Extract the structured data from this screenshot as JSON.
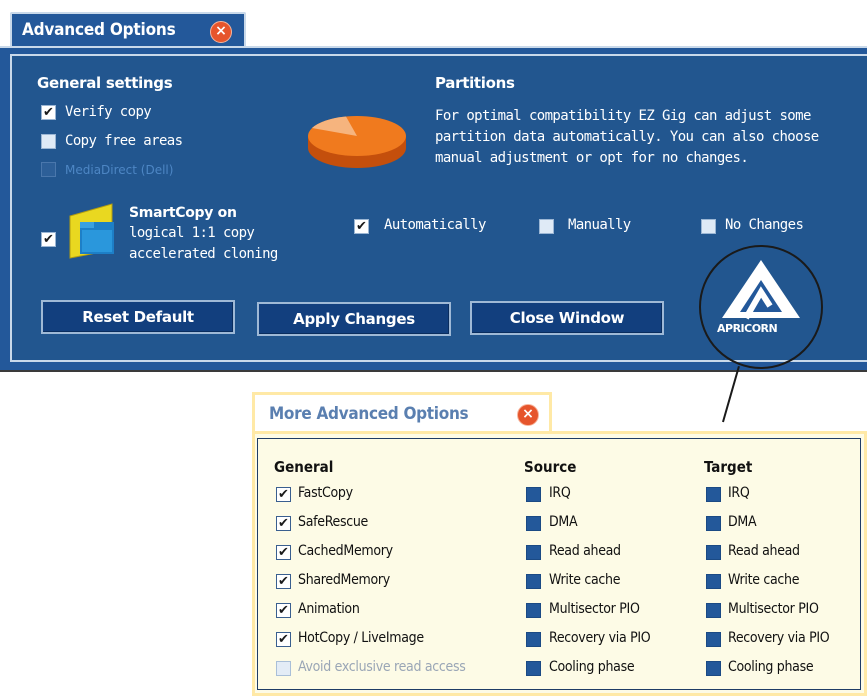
{
  "top": {
    "title": "Advanced Options",
    "close": "×",
    "general": {
      "heading": "General settings",
      "verify_copy": "Verify copy",
      "copy_free_areas": "Copy free areas",
      "mediadirect": "MediaDirect (Dell)"
    },
    "smartcopy": {
      "line1": "SmartCopy on",
      "line2": "logical 1:1 copy",
      "line3": "accelerated cloning"
    },
    "partitions": {
      "heading": "Partitions",
      "desc1": "For optimal compatibility EZ Gig can adjust some",
      "desc2": "partition data automatically. You can also choose",
      "desc3": "manual adjustment or opt for no changes.",
      "automatically": "Automatically",
      "manually": "Manually",
      "no_changes": "No Changes"
    },
    "buttons": {
      "reset": "Reset Default",
      "apply": "Apply Changes",
      "close": "Close Window"
    },
    "logo": "APRICORN",
    "checkmark": "✔"
  },
  "more": {
    "title": "More Advanced Options",
    "close": "×",
    "general": {
      "heading": "General",
      "items": [
        "FastCopy",
        "SafeRescue",
        "CachedMemory",
        "SharedMemory",
        "Animation",
        "HotCopy / LiveImage",
        "Avoid exclusive read access"
      ]
    },
    "source": {
      "heading": "Source",
      "items": [
        "IRQ",
        "DMA",
        "Read ahead",
        "Write cache",
        "Multisector PIO",
        "Recovery via PIO",
        "Cooling phase"
      ]
    },
    "target": {
      "heading": "Target",
      "items": [
        "IRQ",
        "DMA",
        "Read ahead",
        "Write cache",
        "Multisector PIO",
        "Recovery via PIO",
        "Cooling phase"
      ]
    }
  }
}
